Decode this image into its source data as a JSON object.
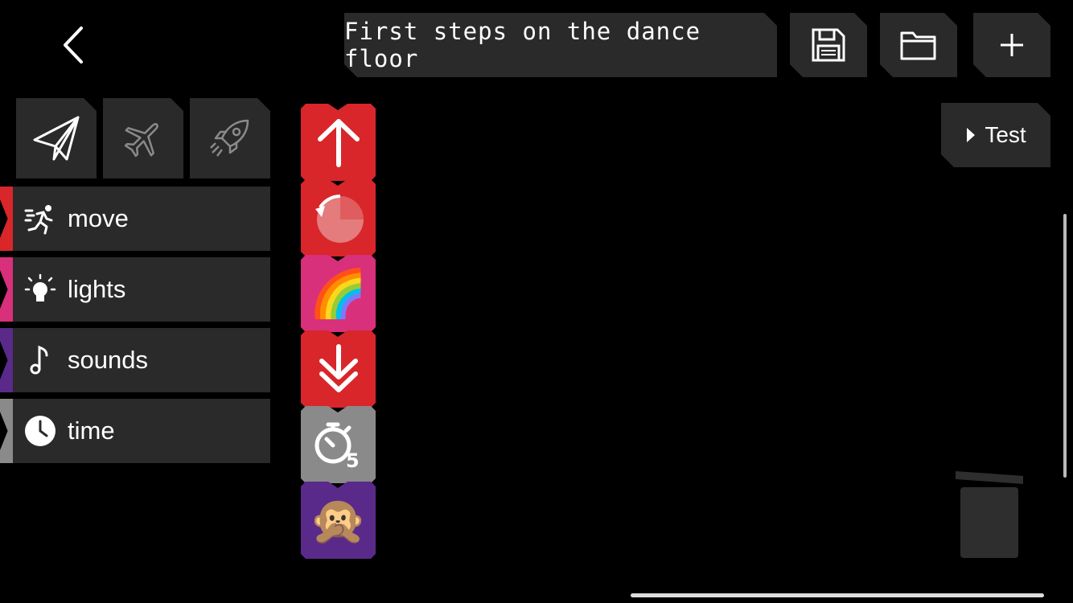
{
  "header": {
    "project_title": "First steps on the dance floor"
  },
  "icons": {
    "back": "chevron-left-icon",
    "save": "save-icon",
    "open": "folder-icon",
    "new": "plus-icon"
  },
  "vehicles": [
    {
      "name": "paper-plane-icon",
      "selected": true
    },
    {
      "name": "airplane-icon",
      "selected": false
    },
    {
      "name": "rocket-icon",
      "selected": false
    }
  ],
  "categories": [
    {
      "label": "move",
      "icon": "running-icon",
      "color": "#d8262a"
    },
    {
      "label": "lights",
      "icon": "lightbulb-icon",
      "color": "#d8307a"
    },
    {
      "label": "sounds",
      "icon": "music-note-icon",
      "color": "#5a2a8a"
    },
    {
      "label": "time",
      "icon": "clock-icon",
      "color": "#8a8a8a"
    }
  ],
  "program_blocks": [
    {
      "type": "move-forward",
      "icon": "arrow-up-icon",
      "color": "#d8262a"
    },
    {
      "type": "rotate",
      "icon": "rotate-icon",
      "color": "#d8262a"
    },
    {
      "type": "lights-rainbow",
      "icon": "rainbow-icon",
      "color": "#d8307a"
    },
    {
      "type": "land",
      "icon": "double-arrow-down-icon",
      "color": "#d8262a"
    },
    {
      "type": "wait",
      "icon": "stopwatch-icon",
      "value": "5",
      "color": "#8a8a8a"
    },
    {
      "type": "sound-monkey",
      "icon": "monkey-icon",
      "color": "#5a2a8a"
    }
  ],
  "test_button": {
    "label": "Test"
  }
}
